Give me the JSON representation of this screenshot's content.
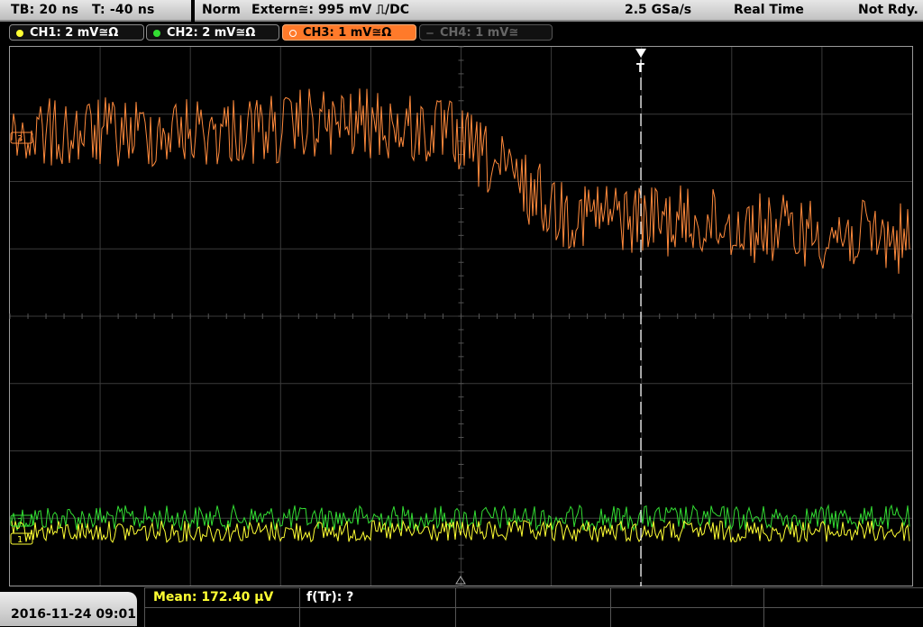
{
  "status_bar": {
    "timebase": "TB: 20 ns",
    "trigger_time": "T: -40 ns",
    "trigger_mode": "Norm",
    "trigger_source": "Extern≅: 995 mV ⎍/DC",
    "sample_rate": "2.5 GSa/s",
    "acq_mode": "Real Time",
    "run_state": "Not Rdy."
  },
  "channels": [
    {
      "label": "CH1: 2 mV≅Ω",
      "color": "#ffff33",
      "state": "on"
    },
    {
      "label": "CH2: 2 mV≅Ω",
      "color": "#33dd33",
      "state": "on"
    },
    {
      "label": "CH3: 1 mV≅Ω",
      "color": "#ff7a2a",
      "state": "active"
    },
    {
      "label": "CH4: 1 mV≅",
      "color": "#666666",
      "state": "off"
    }
  ],
  "trigger_marker": "T",
  "channel_markers": [
    "3",
    "2",
    "1"
  ],
  "measurement": {
    "mean": "Mean: 172.40 µV",
    "ftr": "f(Tr): ?"
  },
  "datetime": "2016-11-24 09:01",
  "colors": {
    "ch1": "#ffff33",
    "ch2": "#33dd33",
    "ch3": "#ff8a3c",
    "grid": "#3a3a3a"
  }
}
